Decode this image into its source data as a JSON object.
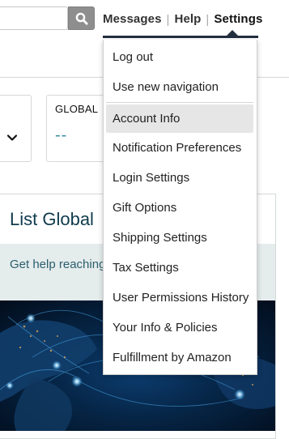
{
  "search": {
    "value": "",
    "placeholder": "",
    "button_icon": "magnifier-icon"
  },
  "topnav": {
    "messages": "Messages",
    "help": "Help",
    "settings": "Settings",
    "separator": "|"
  },
  "cards": {
    "left": {
      "icon": "chevron-down-icon"
    },
    "global": {
      "label": "GLOBAL",
      "value": "--"
    }
  },
  "panel": {
    "title": "List Global",
    "help_text": "Get help reaching listing internatio"
  },
  "settings_menu": {
    "items": [
      {
        "label": "Log out"
      },
      {
        "label": "Use new navigation"
      },
      {
        "label": "Account Info"
      },
      {
        "label": "Notification Preferences"
      },
      {
        "label": "Login Settings"
      },
      {
        "label": "Gift Options"
      },
      {
        "label": "Shipping Settings"
      },
      {
        "label": "Tax Settings"
      },
      {
        "label": "User Permissions History"
      },
      {
        "label": "Your Info & Policies"
      },
      {
        "label": "Fulfillment by Amazon"
      }
    ],
    "hovered_item": "Account Info"
  },
  "colors": {
    "nav_underline": "#232f3e",
    "search_button": "#8e8e8e",
    "value_accent": "#3a8fa3",
    "panel_title": "#0f3b4c",
    "help_band": "#e5ecec",
    "hover_bg": "#e6e6e6"
  }
}
